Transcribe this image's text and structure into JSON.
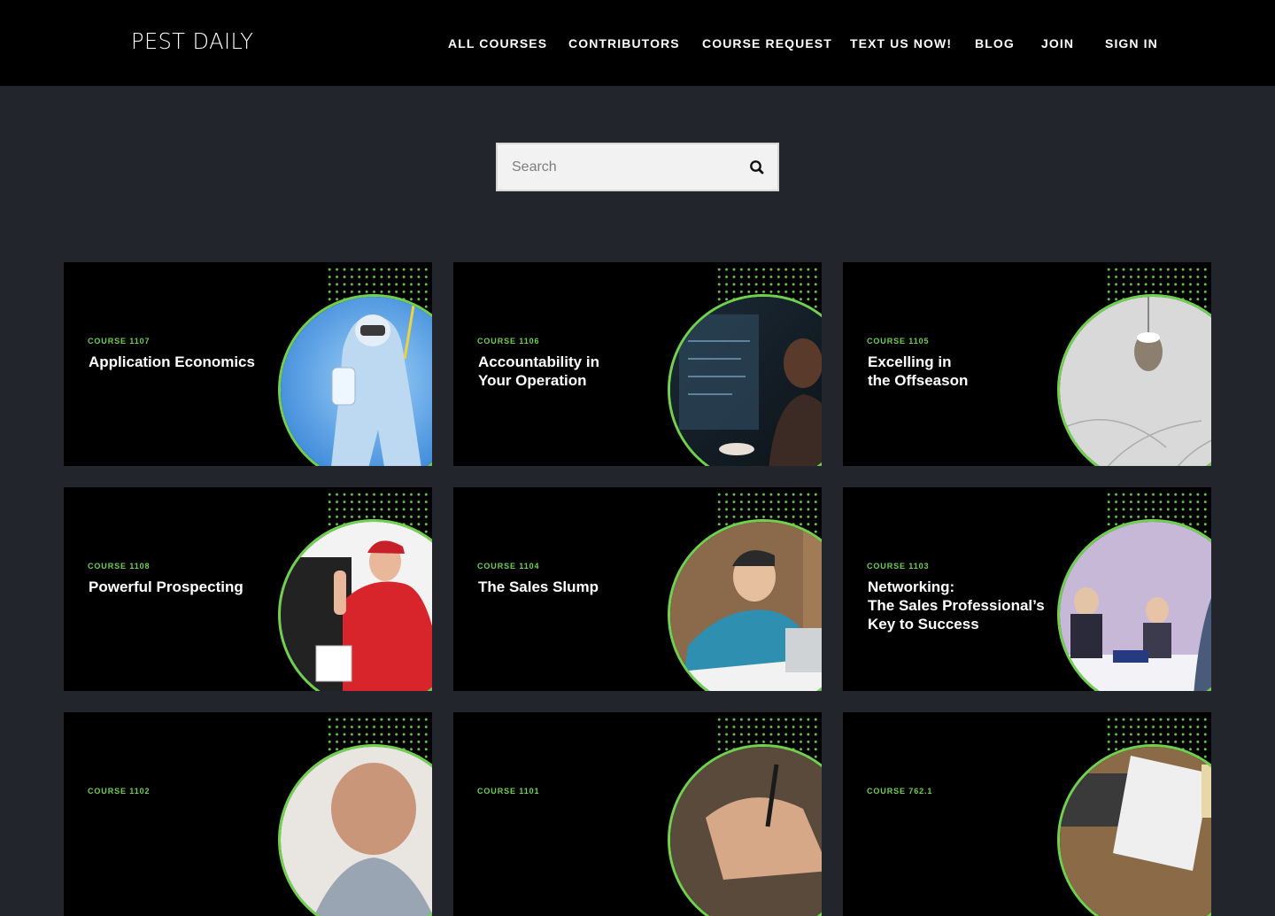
{
  "brand": {
    "logo_text": "PEST DAILY"
  },
  "nav": {
    "items": [
      {
        "label": "ALL COURSES"
      },
      {
        "label": "CONTRIBUTORS"
      },
      {
        "label": "COURSE REQUEST"
      },
      {
        "label": "TEXT US NOW!"
      },
      {
        "label": "BLOG"
      },
      {
        "label": "JOIN"
      },
      {
        "label": "SIGN IN"
      }
    ]
  },
  "search": {
    "placeholder": "Search",
    "icon": "search-icon"
  },
  "colors": {
    "accent": "#6fd14d",
    "page_bg": "#22252b",
    "header_bg": "#000000",
    "card_bg": "#000000"
  },
  "courses": [
    {
      "number": "COURSE 1107",
      "title": "Application Economics",
      "image_icon": "technician-spraying-photo"
    },
    {
      "number": "COURSE 1106",
      "title": "Accountability in\nYour Operation",
      "image_icon": "woman-at-monitor-photo"
    },
    {
      "number": "COURSE 1105",
      "title": "Excelling in\nthe Offseason",
      "image_icon": "wasp-nest-in-snow-photo"
    },
    {
      "number": "COURSE 1108",
      "title": "Powerful Prospecting",
      "image_icon": "man-knocking-door-photo"
    },
    {
      "number": "COURSE 1104",
      "title": "The Sales Slump",
      "image_icon": "stressed-man-laptop-photo"
    },
    {
      "number": "COURSE 1103",
      "title": "Networking:\nThe Sales Professional’s\nKey to Success",
      "image_icon": "conference-networking-photo"
    },
    {
      "number": "COURSE 1102",
      "title": "",
      "image_icon": "bald-man-photo"
    },
    {
      "number": "COURSE 1101",
      "title": "",
      "image_icon": "hand-writing-photo"
    },
    {
      "number": "COURSE 762.1",
      "title": "",
      "image_icon": "desk-papers-photo"
    }
  ]
}
